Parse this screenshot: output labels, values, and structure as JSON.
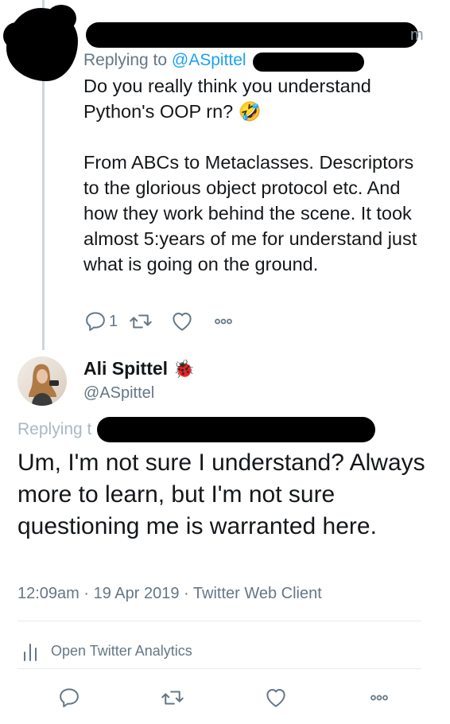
{
  "tweet1": {
    "handle_tail": "m",
    "replying_prefix": "Replying to ",
    "replying_mention": "@ASpittel",
    "paragraphs": [
      "Do you really think you understand Python's OOP rn? 🤣",
      "From ABCs to Metaclasses. Descriptors to the glorious object protocol etc. And how they work behind the scene. It took almost 5:years of me for understand just what is going on the ground."
    ],
    "actions": {
      "reply_count": "1"
    }
  },
  "tweet2": {
    "author_name": "Ali Spittel",
    "author_emoji": "🐞",
    "author_handle": "@ASpittel",
    "replying_prefix": "Replying t",
    "text": "Um, I'm not sure I understand? Always more to learn, but I'm not sure questioning me is warranted here.",
    "timestamp": "12:09am · 19 Apr 2019 · Twitter Web Client",
    "analytics_label": "Open Twitter Analytics"
  },
  "colors": {
    "text": "#14171a",
    "muted": "#657786",
    "link": "#1da1f2",
    "divider": "#e6ecf0",
    "thread": "#ccd6dd"
  },
  "icons": [
    "reply-icon",
    "retweet-icon",
    "like-icon",
    "more-icon",
    "analytics-icon"
  ]
}
